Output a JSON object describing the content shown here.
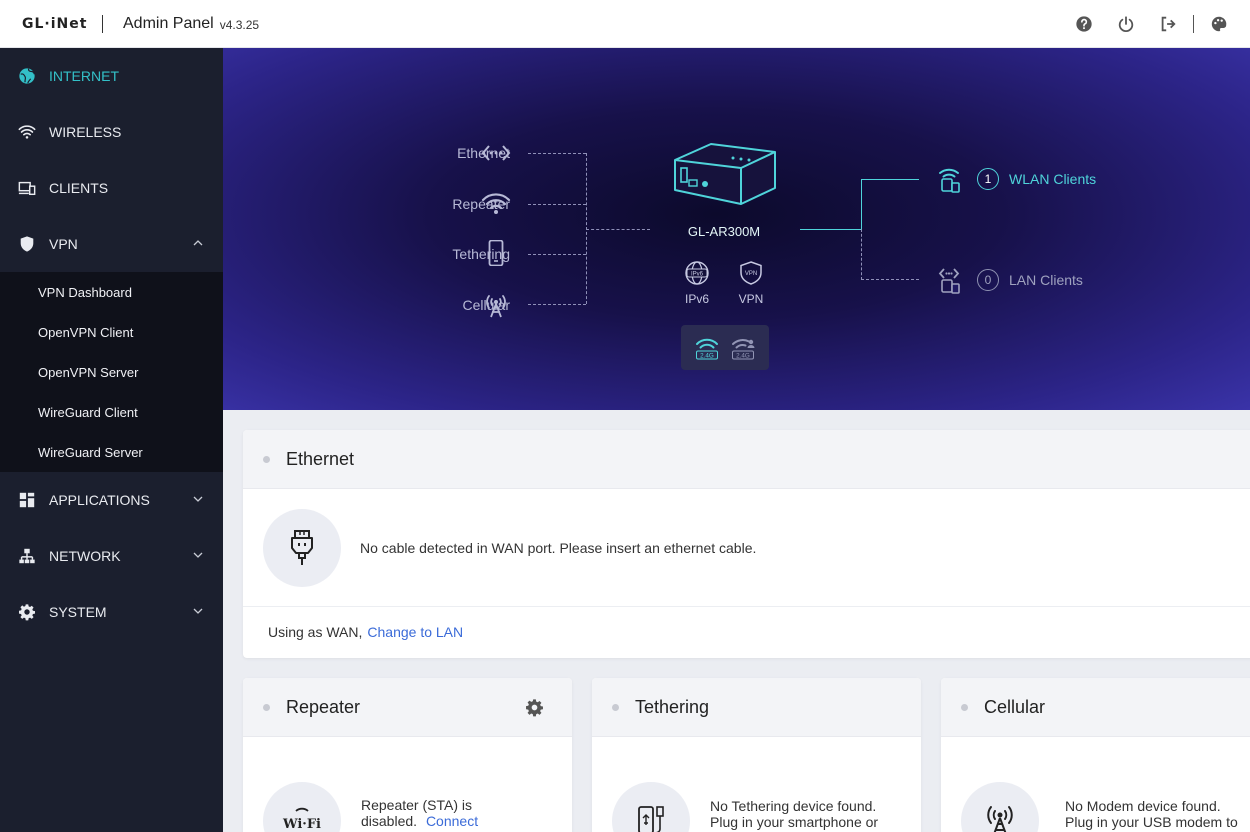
{
  "header": {
    "logo": "GL·iNet",
    "title": "Admin Panel",
    "version": "v4.3.25"
  },
  "sidebar": {
    "items": [
      {
        "label": "INTERNET",
        "icon": "globe-icon",
        "active": true
      },
      {
        "label": "WIRELESS",
        "icon": "wifi-icon"
      },
      {
        "label": "CLIENTS",
        "icon": "devices-icon"
      },
      {
        "label": "VPN",
        "icon": "shield-icon",
        "expanded": true
      }
    ],
    "vpn_sub": [
      "VPN Dashboard",
      "OpenVPN Client",
      "OpenVPN Server",
      "WireGuard Client",
      "WireGuard Server"
    ],
    "items_after": [
      {
        "label": "APPLICATIONS",
        "icon": "apps-icon"
      },
      {
        "label": "NETWORK",
        "icon": "network-icon"
      },
      {
        "label": "SYSTEM",
        "icon": "gear-icon"
      }
    ]
  },
  "banner": {
    "sources": [
      "Ethernet",
      "Repeater",
      "Tethering",
      "Cellular"
    ],
    "router_name": "GL-AR300M",
    "ipv6_label": "IPv6",
    "vpn_label": "VPN",
    "band_label": "2.4G",
    "wlan_count": "1",
    "wlan_label": "WLAN Clients",
    "lan_count": "0",
    "lan_label": "LAN Clients",
    "accent_color": "#4fd4da"
  },
  "ethernet": {
    "title": "Ethernet",
    "message": "No cable detected in WAN port. Please insert an ethernet cable.",
    "footer_text": "Using as WAN,",
    "footer_link": "Change to LAN"
  },
  "repeater": {
    "title": "Repeater",
    "message": "Repeater (STA) is disabled.",
    "link": "Connect"
  },
  "tethering": {
    "title": "Tethering",
    "message": "No Tethering device found. Plug in your smartphone or"
  },
  "cellular": {
    "title": "Cellular",
    "message": "No Modem device found. Plug in your USB modem to"
  }
}
